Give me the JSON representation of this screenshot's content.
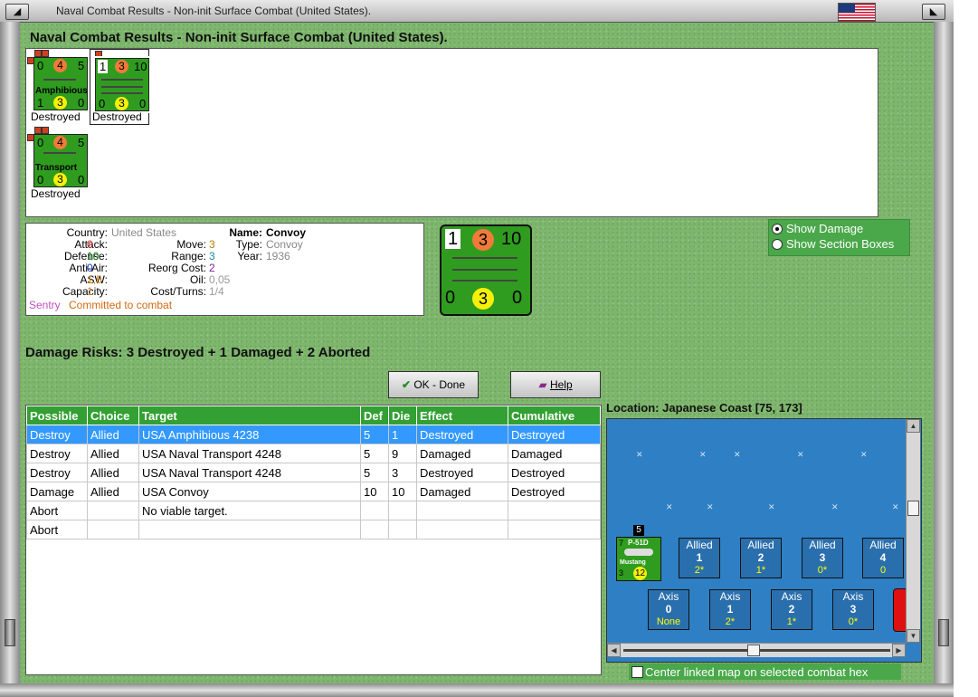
{
  "window": {
    "title": "Naval Combat Results - Non-init Surface Combat (United States)."
  },
  "header": {
    "title": "Naval Combat Results - Non-init Surface Combat (United States)."
  },
  "units": [
    {
      "def": "0",
      "att": "4",
      "move": "5",
      "name": "Amphibious",
      "bl": "1",
      "mid": "3",
      "br": "0",
      "status": "Destroyed"
    },
    {
      "def": "1",
      "att": "3",
      "move": "10",
      "name": "",
      "bl": "0",
      "mid": "3",
      "br": "0",
      "status": "Destroyed"
    },
    {
      "def": "0",
      "att": "4",
      "move": "5",
      "name": "Transport",
      "bl": "0",
      "mid": "3",
      "br": "0",
      "status": "Destroyed"
    }
  ],
  "info": {
    "country_label": "Country:",
    "country": "United States",
    "attack_label": "Attack:",
    "attack": "0",
    "defense_label": "Defense:",
    "defense": "10",
    "antiair_label": "Anti-Air:",
    "antiair": "0",
    "asw_label": "ASW:",
    "asw": "1,5",
    "capacity_label": "Capacity:",
    "capacity": "1",
    "move_label": "Move:",
    "move": "3",
    "range_label": "Range:",
    "range": "3",
    "reorg_label": "Reorg Cost:",
    "reorg": "2",
    "oil_label": "Oil:",
    "oil": "0,05",
    "cost_label": "Cost/Turns:",
    "cost": "1/4",
    "name_label": "Name:",
    "name": "Convoy",
    "type_label": "Type:",
    "type": "Convoy",
    "year_label": "Year:",
    "year": "1936",
    "sentry": "Sentry",
    "status": "Committed to combat"
  },
  "big_counter": {
    "tl": "1",
    "tc": "3",
    "tr": "10",
    "bl": "0",
    "bc": "3",
    "br": "0"
  },
  "options": {
    "show_damage": "Show Damage",
    "show_sections": "Show Section Boxes"
  },
  "risks": "Damage Risks: 3 Destroyed + 1 Damaged + 2 Aborted",
  "buttons": {
    "ok": "OK - Done",
    "help": "Help"
  },
  "table": {
    "headers": [
      "Possible",
      "Choice",
      "Target",
      "Def",
      "Die",
      "Effect",
      "Cumulative"
    ],
    "rows": [
      [
        "Destroy",
        "Allied",
        "USA Amphibious 4238",
        "5",
        "1",
        "Destroyed",
        "Destroyed"
      ],
      [
        "Destroy",
        "Allied",
        "USA Naval Transport 4248",
        "5",
        "9",
        "Damaged",
        "Damaged"
      ],
      [
        "Destroy",
        "Allied",
        "USA Naval Transport 4248",
        "5",
        "3",
        "Destroyed",
        "Destroyed"
      ],
      [
        "Damage",
        "Allied",
        "USA Convoy",
        "10",
        "10",
        "Damaged",
        "Destroyed"
      ],
      [
        "Abort",
        "",
        "No viable target.",
        "",
        "",
        "",
        ""
      ],
      [
        "Abort",
        "",
        "",
        "",
        "",
        "",
        ""
      ]
    ]
  },
  "location": {
    "label": "Location:",
    "value": "Japanese Coast [75, 173]"
  },
  "map": {
    "allied": [
      {
        "side": "Allied",
        "num": "1",
        "val": "2*"
      },
      {
        "side": "Allied",
        "num": "2",
        "val": "1*"
      },
      {
        "side": "Allied",
        "num": "3",
        "val": "0*"
      },
      {
        "side": "Allied",
        "num": "4",
        "val": "0"
      }
    ],
    "axis": [
      {
        "side": "Axis",
        "num": "0",
        "val": "None"
      },
      {
        "side": "Axis",
        "num": "1",
        "val": "2*"
      },
      {
        "side": "Axis",
        "num": "2",
        "val": "1*"
      },
      {
        "side": "Axis",
        "num": "3",
        "val": "0*"
      }
    ],
    "plane": {
      "stack": "5",
      "tl": "7",
      "name": "P-51D",
      "sub": "Mustang",
      "bl": "3",
      "circ": "12"
    }
  },
  "center_check": "Center linked map on selected combat hex",
  "colors": {
    "green_counter": "#2f9c1f",
    "selection": "#3399ff",
    "table_header": "#33a033",
    "sea": "#2f7fc4"
  }
}
